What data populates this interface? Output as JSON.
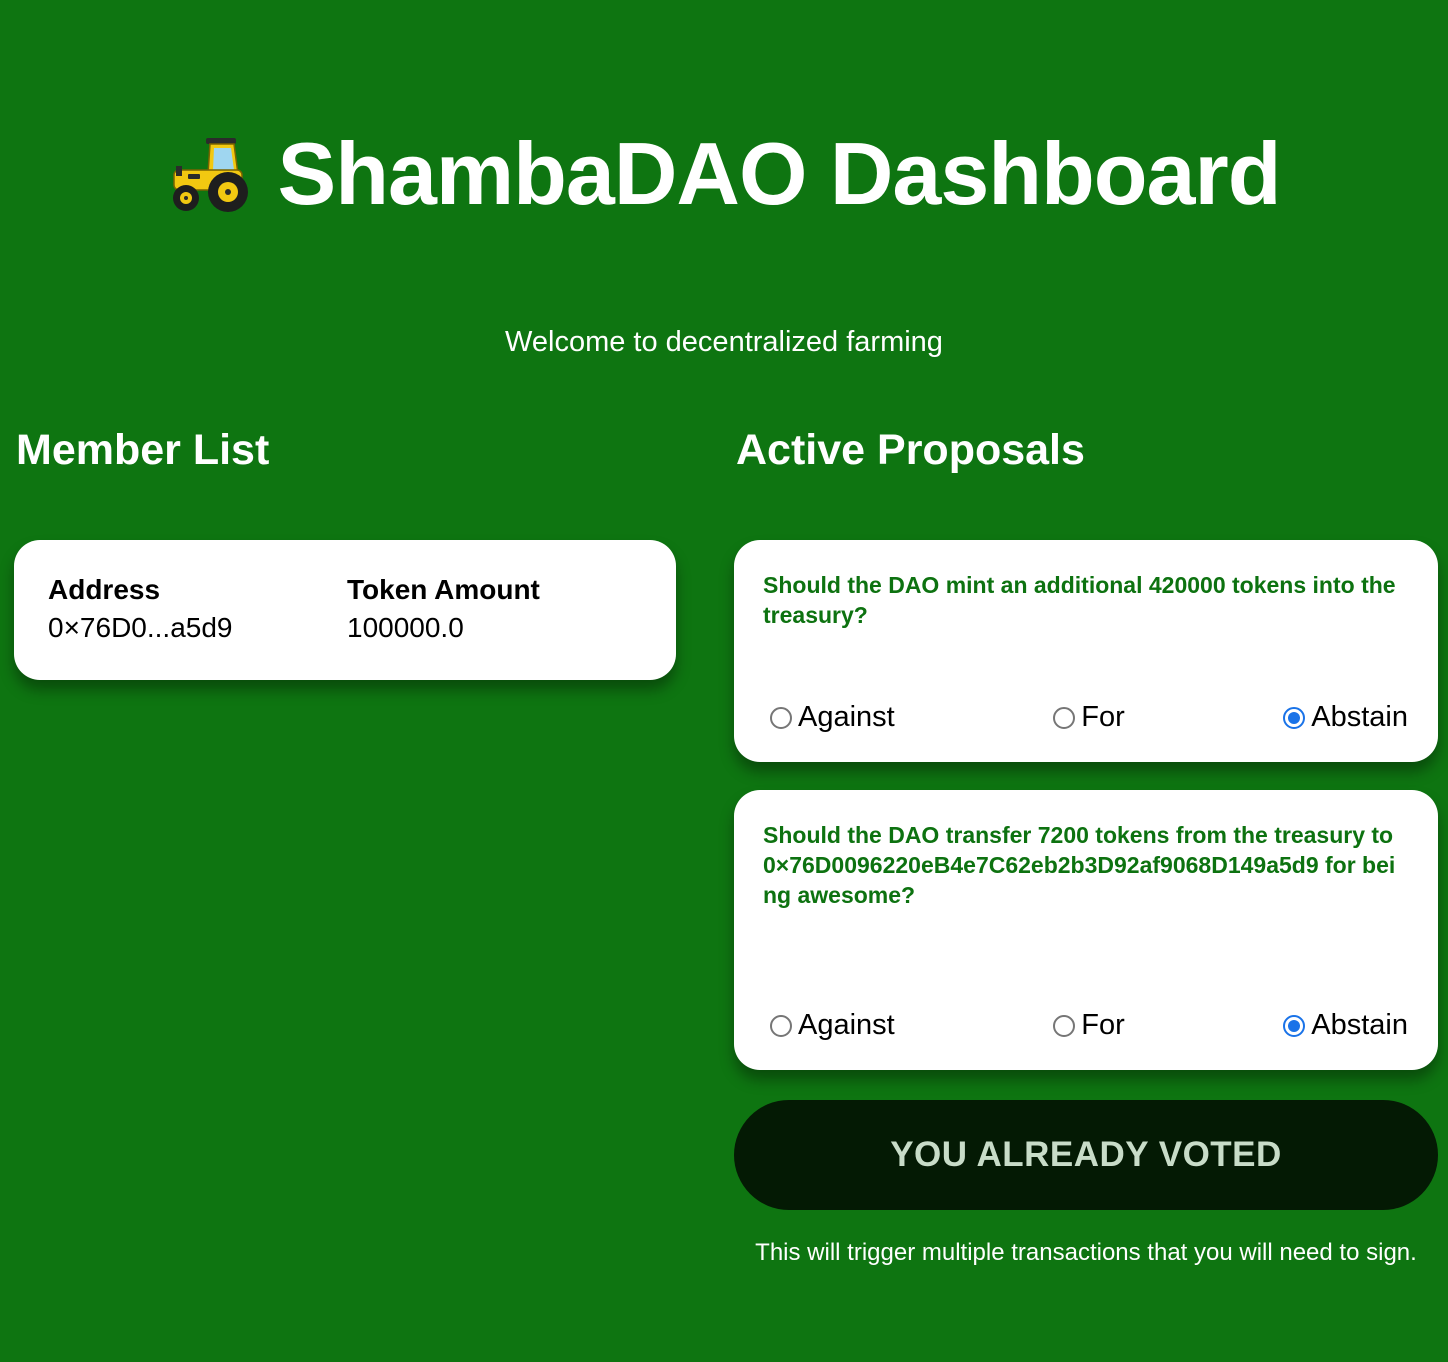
{
  "header": {
    "title": "ShambaDAO Dashboard",
    "title_icon": "tractor-icon",
    "subtitle": "Welcome to decentralized farming"
  },
  "members": {
    "heading": "Member List",
    "columns": [
      "Address",
      "Token Amount"
    ],
    "rows": [
      {
        "address": "0×76D0...a5d9",
        "amount": "100000.0"
      }
    ]
  },
  "proposals": {
    "heading": "Active Proposals",
    "options": [
      "Against",
      "For",
      "Abstain"
    ],
    "items": [
      {
        "text": "Should the DAO mint an additional 420000 tokens into the treasury?",
        "selected": "Abstain"
      },
      {
        "text": "Should the DAO transfer 7200 tokens from the treasury to 0×76D0096220eB4e7C62eb2b3D92af9068D149a5d9 for being awesome?",
        "selected": "Abstain"
      }
    ]
  },
  "vote_button": {
    "label": "YOU ALREADY VOTED"
  },
  "note": "This will trigger multiple transactions that you will need to sign.",
  "colors": {
    "background": "#0e7511",
    "proposal_text": "#0d7210",
    "button_bg": "#041a04",
    "radio_selected": "#1a73e8"
  }
}
